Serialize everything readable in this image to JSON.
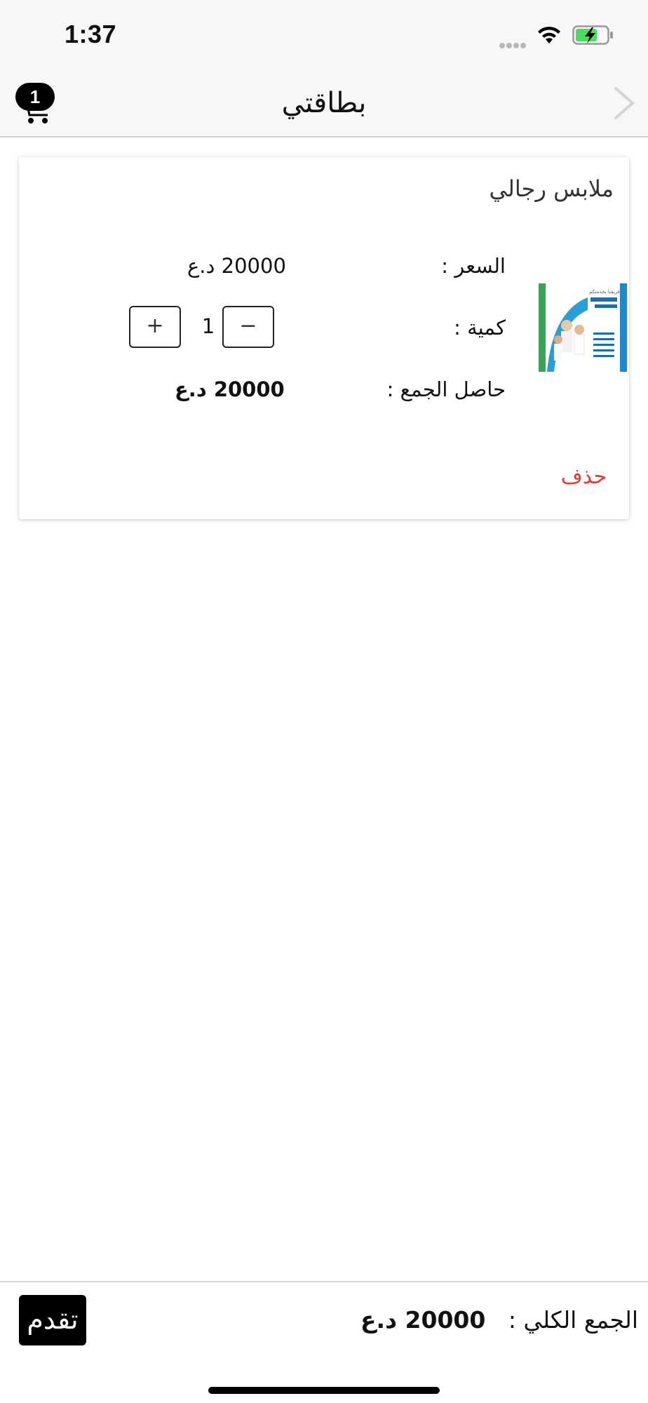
{
  "status_bar": {
    "time": "1:37",
    "icons": [
      "signal-dots-icon",
      "wifi-icon",
      "battery-charging-icon"
    ],
    "battery_color": "#4cd964"
  },
  "nav": {
    "title": "بطاقتي",
    "cart_count": "1",
    "left_icon": "cart-icon",
    "right_icon": "chevron-right-icon"
  },
  "cart_item": {
    "name": "ملابس رجالي",
    "price_label": "السعر :",
    "price_value": "20000 د.ع",
    "quantity_label": "كمية :",
    "quantity": "1",
    "minus_symbol": "−",
    "plus_symbol": "+",
    "subtotal_label": "حاصل الجمع   :",
    "subtotal_value": "20000 د.ع",
    "delete_label": "حذف",
    "image_caption": "فريقنا بخدمتكم"
  },
  "footer": {
    "total_label": "الجمع الكلي  :",
    "total_value": "20000 د.ع",
    "proceed_label": "تقدم"
  },
  "colors": {
    "accent": "#000000",
    "delete": "#e53935",
    "bar_background": "#f7f7f7"
  }
}
